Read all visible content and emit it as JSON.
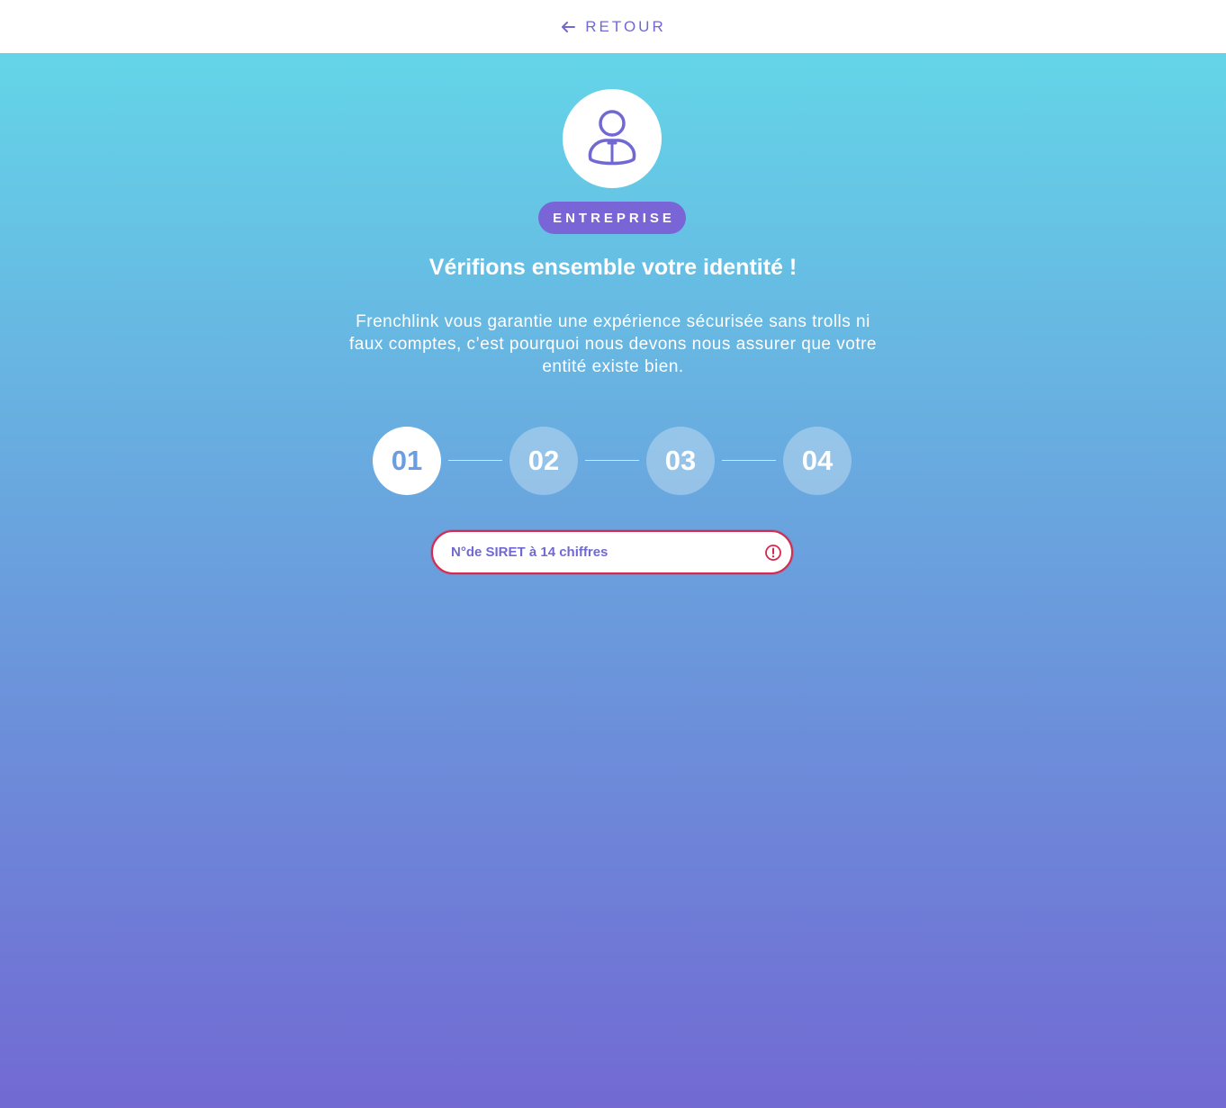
{
  "header": {
    "back_label": "RETOUR",
    "back_icon": "arrow-left-icon"
  },
  "profile": {
    "icon": "business-person-icon",
    "badge_label": "ENTREPRISE"
  },
  "main": {
    "title": "Vérifions ensemble votre identité !",
    "description": "Frenchlink vous garantie une expérience sécurisée sans trolls ni faux comptes, c’est pourquoi nous devons nous assurer que votre entité existe bien."
  },
  "steps": {
    "current": 1,
    "items": [
      {
        "label": "01"
      },
      {
        "label": "02"
      },
      {
        "label": "03"
      },
      {
        "label": "04"
      }
    ]
  },
  "siret": {
    "value": "",
    "placeholder": "N°de SIRET à 14 chiffres",
    "status_icon": "error-icon"
  },
  "colors": {
    "accent": "#7169d3",
    "gradient_top": "#64d5e8",
    "gradient_bottom": "#7269d3",
    "badge": "#7a65d6",
    "error": "#d7284d",
    "active_step_text": "#6b9ee0"
  }
}
